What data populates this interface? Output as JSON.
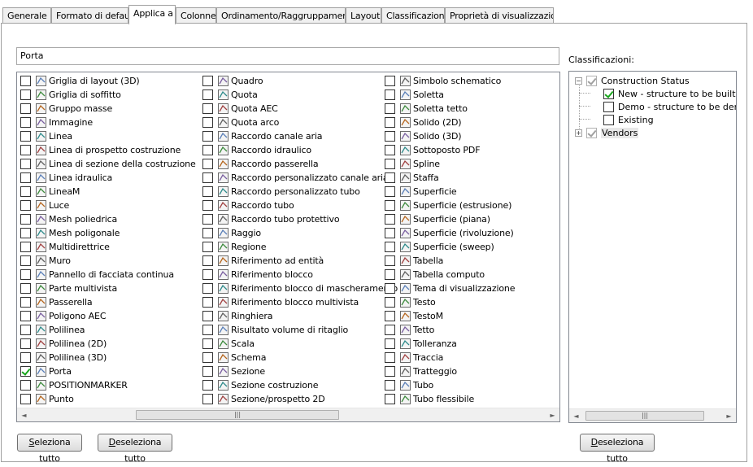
{
  "tabs": [
    {
      "label": "Generale"
    },
    {
      "label": "Formato di default"
    },
    {
      "label": "Applica a"
    },
    {
      "label": "Colonne"
    },
    {
      "label": "Ordinamento/Raggruppamento"
    },
    {
      "label": "Layout"
    },
    {
      "label": "Classificazioni"
    },
    {
      "label": "Proprietà di visualizzazione"
    }
  ],
  "active_tab": "Applica a",
  "search": {
    "value": "Porta"
  },
  "object_list": {
    "columns": [
      [
        {
          "label": "Griglia di layout (3D)",
          "icon": "layout-grid-3d-icon",
          "checked": false
        },
        {
          "label": "Griglia di soffitto",
          "icon": "ceiling-grid-icon",
          "checked": false
        },
        {
          "label": "Gruppo masse",
          "icon": "mass-group-icon",
          "checked": false
        },
        {
          "label": "Immagine",
          "icon": "image-icon",
          "checked": false
        },
        {
          "label": "Linea",
          "icon": "line-icon",
          "checked": false
        },
        {
          "label": "Linea di prospetto costruzione",
          "icon": "elevation-line-icon",
          "checked": false
        },
        {
          "label": "Linea di sezione della costruzione",
          "icon": "section-line-icon",
          "checked": false
        },
        {
          "label": "Linea idraulica",
          "icon": "pipe-line-icon",
          "checked": false
        },
        {
          "label": "LineaM",
          "icon": "mline-icon",
          "checked": false
        },
        {
          "label": "Luce",
          "icon": "light-icon",
          "checked": false
        },
        {
          "label": "Mesh poliedrica",
          "icon": "polyface-mesh-icon",
          "checked": false
        },
        {
          "label": "Mesh poligonale",
          "icon": "polygon-mesh-icon",
          "checked": false
        },
        {
          "label": "Multidirettrice",
          "icon": "multileader-icon",
          "checked": false
        },
        {
          "label": "Muro",
          "icon": "wall-icon",
          "checked": false
        },
        {
          "label": "Pannello di facciata continua",
          "icon": "curtain-wall-icon",
          "checked": false
        },
        {
          "label": "Parte multivista",
          "icon": "multiview-part-icon",
          "checked": false
        },
        {
          "label": "Passerella",
          "icon": "walkway-icon",
          "checked": false
        },
        {
          "label": "Poligono AEC",
          "icon": "polygon-icon",
          "checked": false
        },
        {
          "label": "Polilinea",
          "icon": "polyline-icon",
          "checked": false
        },
        {
          "label": "Polilinea (2D)",
          "icon": "polyline-2d-icon",
          "checked": false
        },
        {
          "label": "Polilinea (3D)",
          "icon": "polyline-3d-icon",
          "checked": false
        },
        {
          "label": "Porta",
          "icon": "door-icon",
          "checked": true
        },
        {
          "label": "POSITIONMARKER",
          "icon": "position-marker-icon",
          "checked": false
        },
        {
          "label": "Punto",
          "icon": "point-icon",
          "checked": false
        }
      ],
      [
        {
          "label": "Quadro",
          "icon": "panel-icon",
          "checked": false
        },
        {
          "label": "Quota",
          "icon": "dimension-icon",
          "checked": false
        },
        {
          "label": "Quota AEC",
          "icon": "aec-dimension-icon",
          "checked": false
        },
        {
          "label": "Quota arco",
          "icon": "arc-dimension-icon",
          "checked": false
        },
        {
          "label": "Raccordo canale aria",
          "icon": "duct-fitting-icon",
          "checked": false
        },
        {
          "label": "Raccordo idraulico",
          "icon": "pipe-fitting-icon",
          "checked": false
        },
        {
          "label": "Raccordo passerella",
          "icon": "walkway-fitting-icon",
          "checked": false
        },
        {
          "label": "Raccordo personalizzato canale aria",
          "icon": "custom-duct-fitting-icon",
          "checked": false
        },
        {
          "label": "Raccordo personalizzato tubo",
          "icon": "custom-tube-fitting-icon",
          "checked": false
        },
        {
          "label": "Raccordo tubo",
          "icon": "tube-fitting-icon",
          "checked": false
        },
        {
          "label": "Raccordo tubo protettivo",
          "icon": "conduit-fitting-icon",
          "checked": false
        },
        {
          "label": "Raggio",
          "icon": "ray-icon",
          "checked": false
        },
        {
          "label": "Regione",
          "icon": "region-icon",
          "checked": false
        },
        {
          "label": "Riferimento ad entità",
          "icon": "entity-reference-icon",
          "checked": false
        },
        {
          "label": "Riferimento blocco",
          "icon": "block-reference-icon",
          "checked": false
        },
        {
          "label": "Riferimento blocco di mascheramento",
          "icon": "masking-block-icon",
          "checked": false
        },
        {
          "label": "Riferimento blocco multivista",
          "icon": "multiview-block-icon",
          "checked": false
        },
        {
          "label": "Ringhiera",
          "icon": "railing-icon",
          "checked": false
        },
        {
          "label": "Risultato volume di ritaglio",
          "icon": "clip-volume-icon",
          "checked": false
        },
        {
          "label": "Scala",
          "icon": "stair-icon",
          "checked": false
        },
        {
          "label": "Schema",
          "icon": "schematic-icon",
          "checked": false
        },
        {
          "label": "Sezione",
          "icon": "section-icon",
          "checked": false
        },
        {
          "label": "Sezione costruzione",
          "icon": "building-section-icon",
          "checked": false
        },
        {
          "label": "Sezione/prospetto 2D",
          "icon": "section-elevation-2d-icon",
          "checked": false
        }
      ],
      [
        {
          "label": "Simbolo schematico",
          "icon": "schematic-symbol-icon",
          "checked": false
        },
        {
          "label": "Soletta",
          "icon": "slab-icon",
          "checked": false
        },
        {
          "label": "Soletta tetto",
          "icon": "roof-slab-icon",
          "checked": false
        },
        {
          "label": "Solido (2D)",
          "icon": "solid-2d-icon",
          "checked": false
        },
        {
          "label": "Solido (3D)",
          "icon": "solid-3d-icon",
          "checked": false
        },
        {
          "label": "Sottoposto PDF",
          "icon": "pdf-underlay-icon",
          "checked": false
        },
        {
          "label": "Spline",
          "icon": "spline-icon",
          "checked": false
        },
        {
          "label": "Staffa",
          "icon": "hanger-icon",
          "checked": false
        },
        {
          "label": "Superficie",
          "icon": "surface-icon",
          "checked": false
        },
        {
          "label": "Superficie (estrusione)",
          "icon": "extruded-surface-icon",
          "checked": false
        },
        {
          "label": "Superficie (piana)",
          "icon": "planar-surface-icon",
          "checked": false
        },
        {
          "label": "Superficie (rivoluzione)",
          "icon": "revolved-surface-icon",
          "checked": false
        },
        {
          "label": "Superficie (sweep)",
          "icon": "swept-surface-icon",
          "checked": false
        },
        {
          "label": "Tabella",
          "icon": "table-icon",
          "checked": false
        },
        {
          "label": "Tabella computo",
          "icon": "schedule-table-icon",
          "checked": false
        },
        {
          "label": "Tema di visualizzazione",
          "icon": "display-theme-icon",
          "checked": false
        },
        {
          "label": "Testo",
          "icon": "text-icon",
          "checked": false
        },
        {
          "label": "TestoM",
          "icon": "mtext-icon",
          "checked": false
        },
        {
          "label": "Tetto",
          "icon": "roof-icon",
          "checked": false
        },
        {
          "label": "Tolleranza",
          "icon": "tolerance-icon",
          "checked": false
        },
        {
          "label": "Traccia",
          "icon": "trace-icon",
          "checked": false
        },
        {
          "label": "Tratteggio",
          "icon": "hatch-icon",
          "checked": false
        },
        {
          "label": "Tubo",
          "icon": "tube-icon",
          "checked": false
        },
        {
          "label": "Tubo flessibile",
          "icon": "flex-tube-icon",
          "checked": false
        }
      ]
    ]
  },
  "classifications": {
    "label": "Classificazioni:",
    "tree": [
      {
        "label": "Construction Status",
        "checked": true,
        "level": 0,
        "expander": "−"
      },
      {
        "label": "New - structure to be built",
        "checked": true,
        "level": 1
      },
      {
        "label": "Demo - structure to be demolis",
        "checked": false,
        "level": 1
      },
      {
        "label": "Existing",
        "checked": false,
        "level": 1
      },
      {
        "label": "Vendors",
        "checked": true,
        "level": 0,
        "expander": "+"
      }
    ]
  },
  "buttons": {
    "select_all_u": "S",
    "select_all_rest": "eleziona tutto",
    "deselect_all_u": "D",
    "deselect_all_rest": "eseleziona tutto",
    "deselect_class_u": "D",
    "deselect_class_rest": "eseleziona tutto"
  },
  "scroll_glyphs": {
    "left": "◄",
    "right": "►",
    "grip": "|||"
  }
}
